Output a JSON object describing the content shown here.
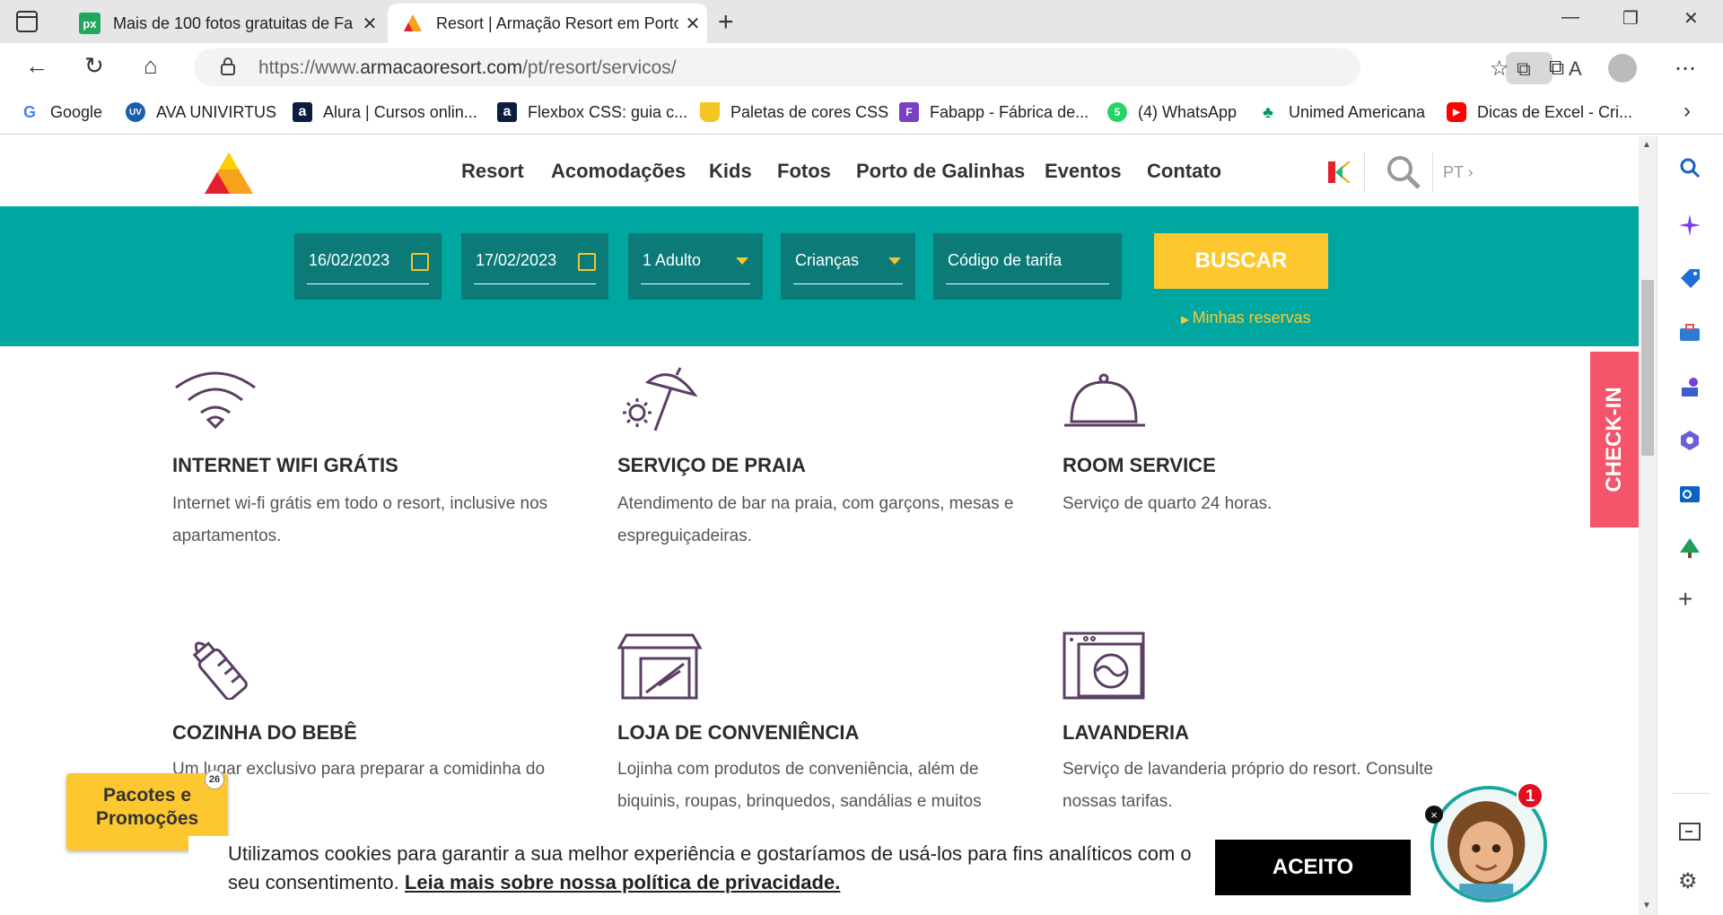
{
  "browser": {
    "tabs": [
      {
        "title": "Mais de 100 fotos gratuitas de Fa",
        "favicon": "px",
        "active": false
      },
      {
        "title": "Resort | Armação Resort em Porto",
        "favicon": "armacao-logo",
        "active": true
      }
    ],
    "url_prefix": "https://www.",
    "url_domain": "armacaoresort.com",
    "url_path": "/pt/resort/servicos/",
    "bookmarks": [
      {
        "label": "Google",
        "icon": "G"
      },
      {
        "label": "AVA UNIVIRTUS",
        "icon": "UV"
      },
      {
        "label": "Alura | Cursos onlin...",
        "icon": "a"
      },
      {
        "label": "Flexbox CSS: guia c...",
        "icon": "a"
      },
      {
        "label": "Paletas de cores CSS",
        "icon": "cup"
      },
      {
        "label": "Fabapp - Fábrica de...",
        "icon": "F"
      },
      {
        "label": "(4) WhatsApp",
        "icon": "5"
      },
      {
        "label": "Unimed Americana",
        "icon": "U"
      },
      {
        "label": "Dicas de Excel - Cri...",
        "icon": "yt"
      }
    ]
  },
  "site": {
    "menu": [
      "Resort",
      "Acomodações",
      "Kids",
      "Fotos",
      "Porto de Galinhas",
      "Eventos",
      "Contato"
    ],
    "lang": "PT ›",
    "booking": {
      "checkin": "16/02/2023",
      "checkout": "17/02/2023",
      "adults": "1 Adulto",
      "children": "Crianças",
      "rate_code": "Código de tarifa",
      "search_button": "BUSCAR",
      "my_reservations": "Minhas reservas"
    },
    "services": [
      {
        "title": "INTERNET WIFI GRÁTIS",
        "text": "Internet wi-fi grátis em todo o resort, inclusive nos apartamentos.",
        "icon": "wifi-icon"
      },
      {
        "title": "SERVIÇO DE PRAIA",
        "text": "Atendimento de bar na praia, com garçons, mesas e espreguiçadeiras.",
        "icon": "beach-umbrella-icon"
      },
      {
        "title": "ROOM SERVICE",
        "text": "Serviço de quarto 24 horas.",
        "icon": "cloche-icon"
      },
      {
        "title": "COZINHA DO BEBÊ",
        "text": "Um lugar exclusivo para preparar a comidinha do bebê.",
        "icon": "baby-bottle-icon"
      },
      {
        "title": "LOJA DE CONVENIÊNCIA",
        "text": "Lojinha com produtos de conveniência, além de biquinis, roupas, brinquedos, sandálias e muitos",
        "icon": "store-icon"
      },
      {
        "title": "LAVANDERIA",
        "text": "Serviço de lavanderia próprio do resort. Consulte nossas tarifas.",
        "icon": "washing-machine-icon"
      }
    ],
    "checkin_tab": "CHECK-IN",
    "promo_button": "Pacotes e Promoções",
    "promo_badge": "26",
    "cookie": {
      "text": "Utilizamos cookies para garantir a sua melhor experiência e gostaríamos de usá-los para fins analíticos com o seu consentimento.",
      "link": "Leia mais sobre nossa política de privacidade.",
      "accept": "ACEITO"
    },
    "chat_badge": "1",
    "chat_close": "×"
  },
  "colors": {
    "teal": "#00a7a1",
    "dark_teal": "#0c7a77",
    "yellow": "#fdc82f",
    "coral": "#f4556a",
    "purple_icon": "#5b3e63"
  }
}
